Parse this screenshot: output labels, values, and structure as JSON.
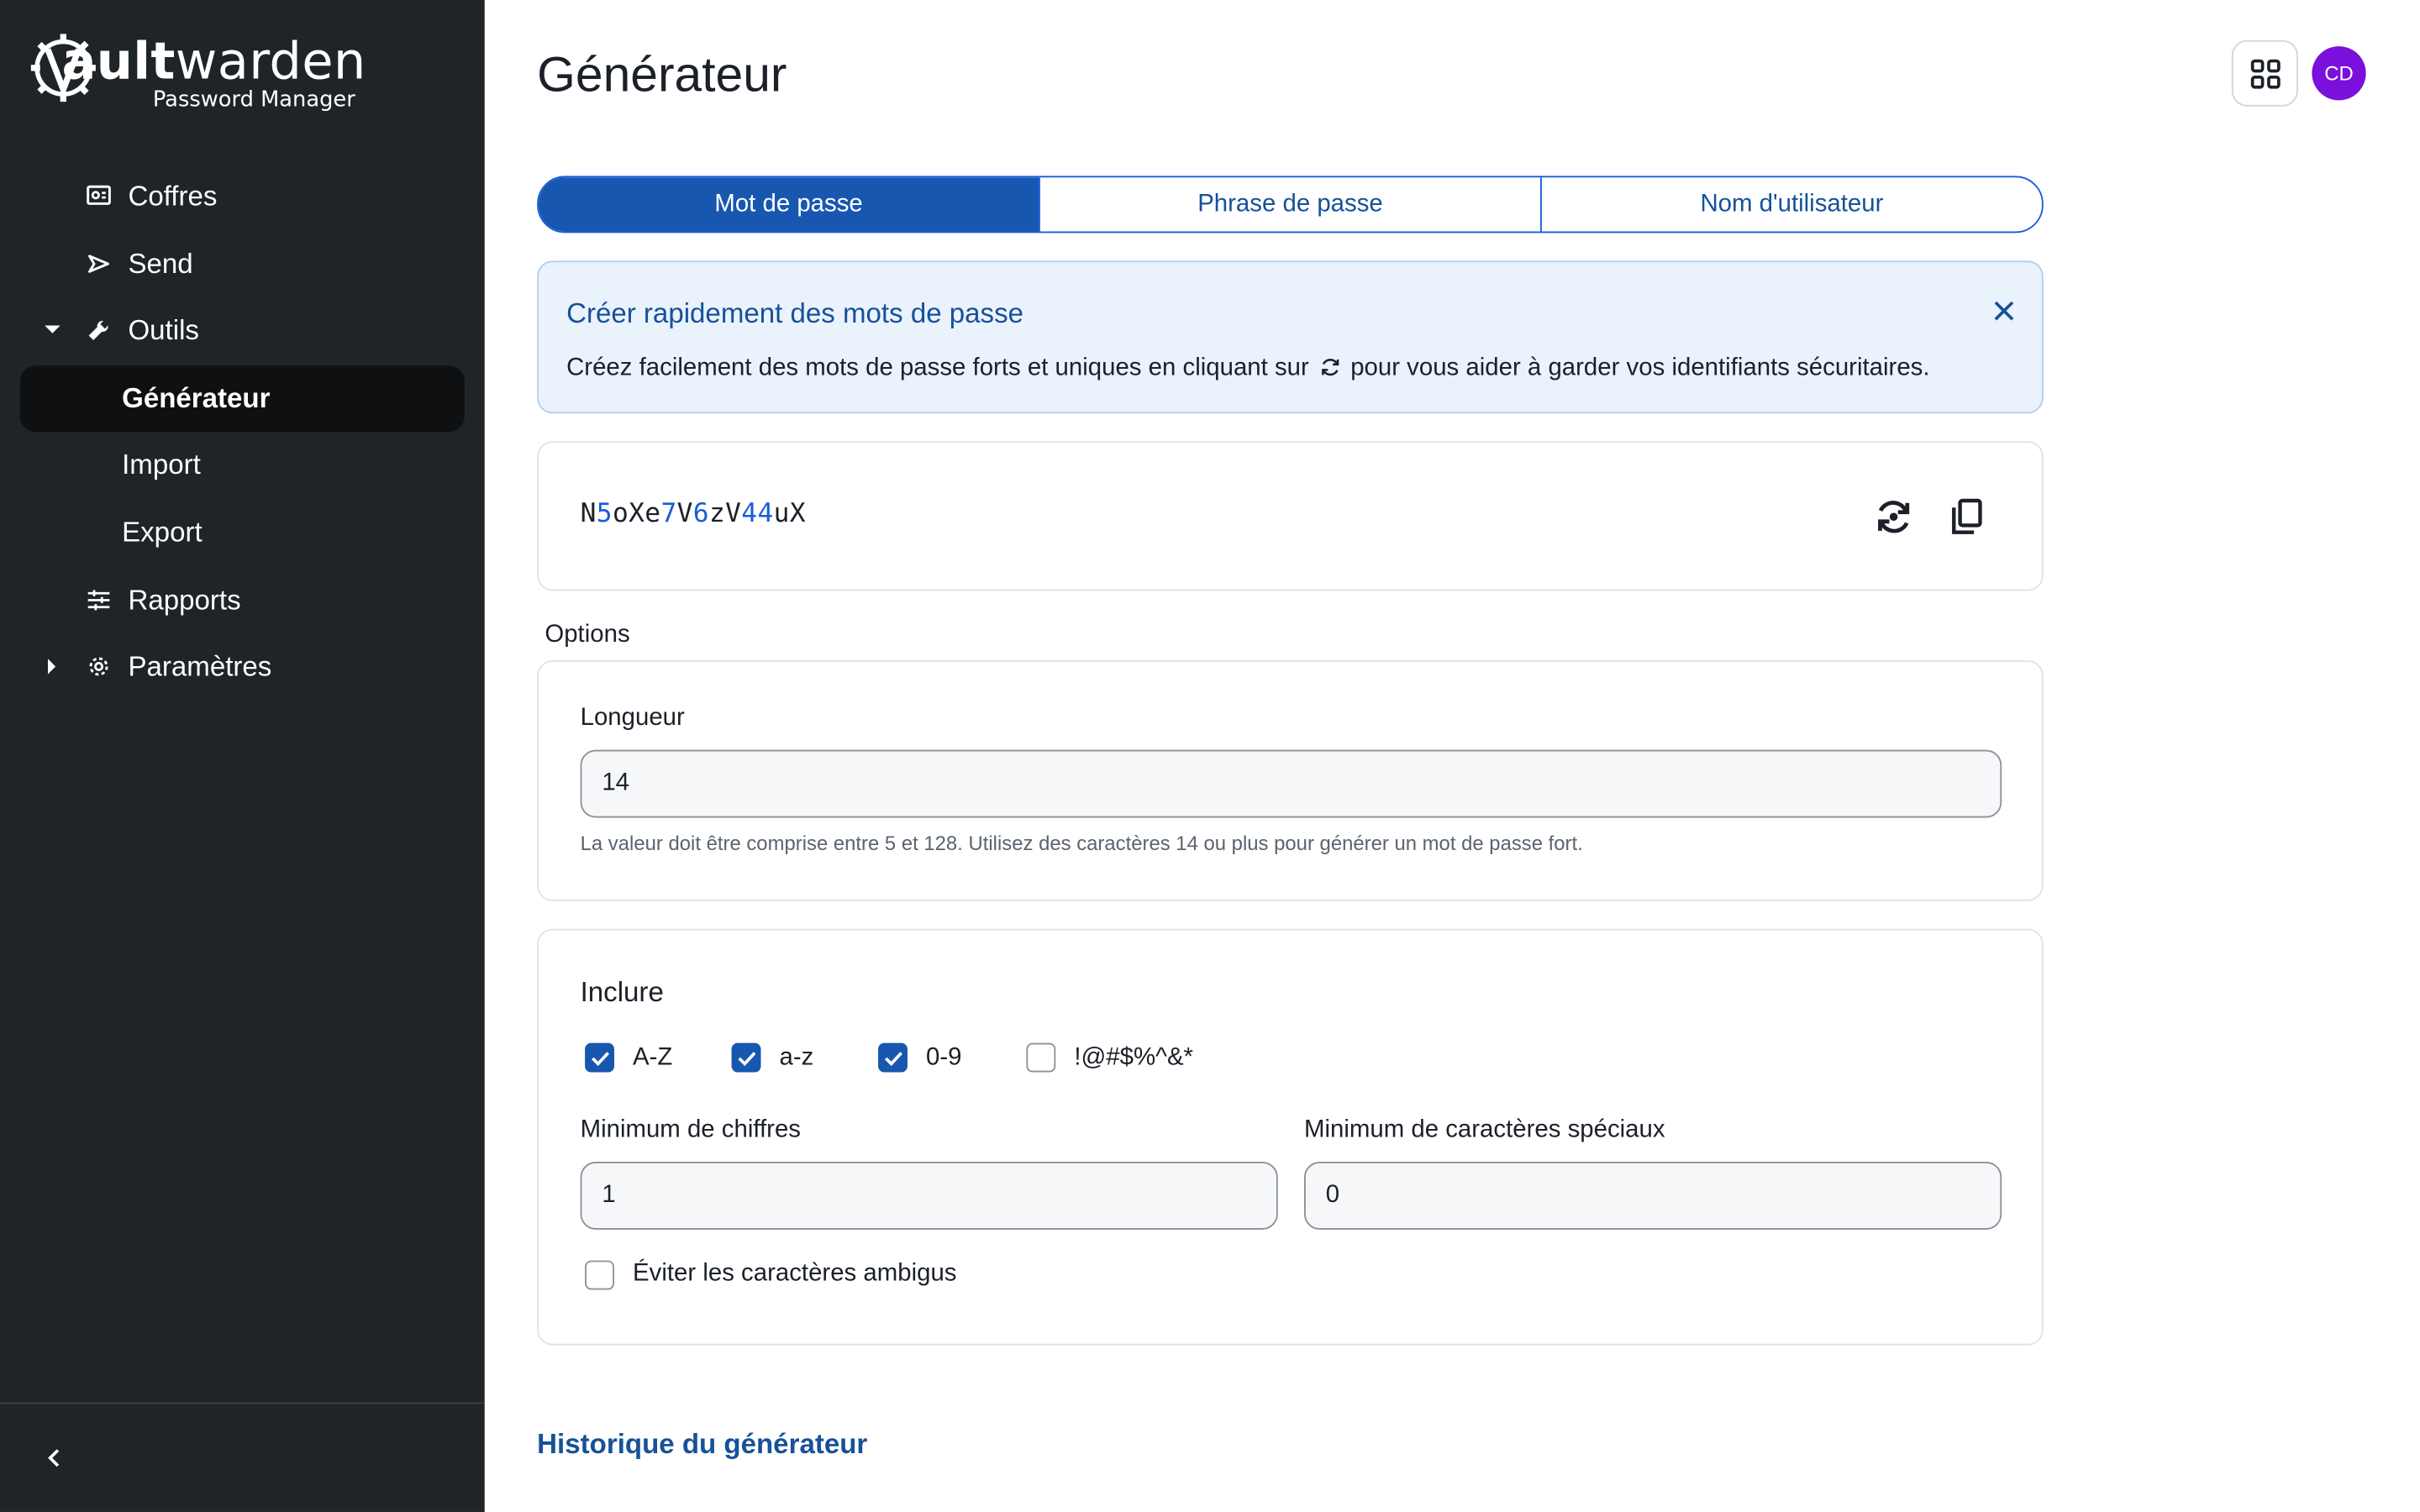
{
  "app": {
    "logo_word_bold": "ault",
    "logo_word_rest": "warden",
    "logo_sub": "Password Manager"
  },
  "sidebar": {
    "items": [
      {
        "label": "Coffres",
        "icon": "vault-icon"
      },
      {
        "label": "Send",
        "icon": "send-icon"
      },
      {
        "label": "Outils",
        "icon": "wrench-icon"
      },
      {
        "label": "Générateur"
      },
      {
        "label": "Import"
      },
      {
        "label": "Export"
      },
      {
        "label": "Rapports",
        "icon": "sliders-icon"
      },
      {
        "label": "Paramètres",
        "icon": "gear-icon"
      }
    ]
  },
  "header": {
    "title": "Générateur",
    "avatar_initials": "CD",
    "avatar_color": "#7b0fdc"
  },
  "tabs": [
    {
      "label": "Mot de passe",
      "active": true
    },
    {
      "label": "Phrase de passe",
      "active": false
    },
    {
      "label": "Nom d'utilisateur",
      "active": false
    }
  ],
  "callout": {
    "title": "Créer rapidement des mots de passe",
    "body_before": "Créez facilement des mots de passe forts et uniques en cliquant sur",
    "body_after": "pour vous aider à garder vos identifiants sécuritaires."
  },
  "password": {
    "segments": [
      {
        "t": "N",
        "digit": false
      },
      {
        "t": "5",
        "digit": true
      },
      {
        "t": "oXe",
        "digit": false
      },
      {
        "t": "7",
        "digit": true
      },
      {
        "t": "V",
        "digit": false
      },
      {
        "t": "6",
        "digit": true
      },
      {
        "t": "zV",
        "digit": false
      },
      {
        "t": "44",
        "digit": true
      },
      {
        "t": "uX",
        "digit": false
      }
    ]
  },
  "options": {
    "section_label": "Options",
    "length_label": "Longueur",
    "length_value": "14",
    "length_hint": "La valeur doit être comprise entre 5 et 128. Utilisez des caractères 14 ou plus pour générer un mot de passe fort.",
    "include_title": "Inclure",
    "include": [
      {
        "label": "A-Z",
        "checked": true
      },
      {
        "label": "a-z",
        "checked": true
      },
      {
        "label": "0-9",
        "checked": true
      },
      {
        "label": "!@#$%^&*",
        "checked": false
      }
    ],
    "min_digits_label": "Minimum de chiffres",
    "min_digits_value": "1",
    "min_special_label": "Minimum de caractères spéciaux",
    "min_special_value": "0",
    "avoid_ambiguous_label": "Éviter les caractères ambigus",
    "avoid_ambiguous_checked": false
  },
  "history_link": "Historique du générateur",
  "colors": {
    "sidebar_bg": "#1f2428",
    "accent": "#1857b0",
    "link": "#175199"
  }
}
